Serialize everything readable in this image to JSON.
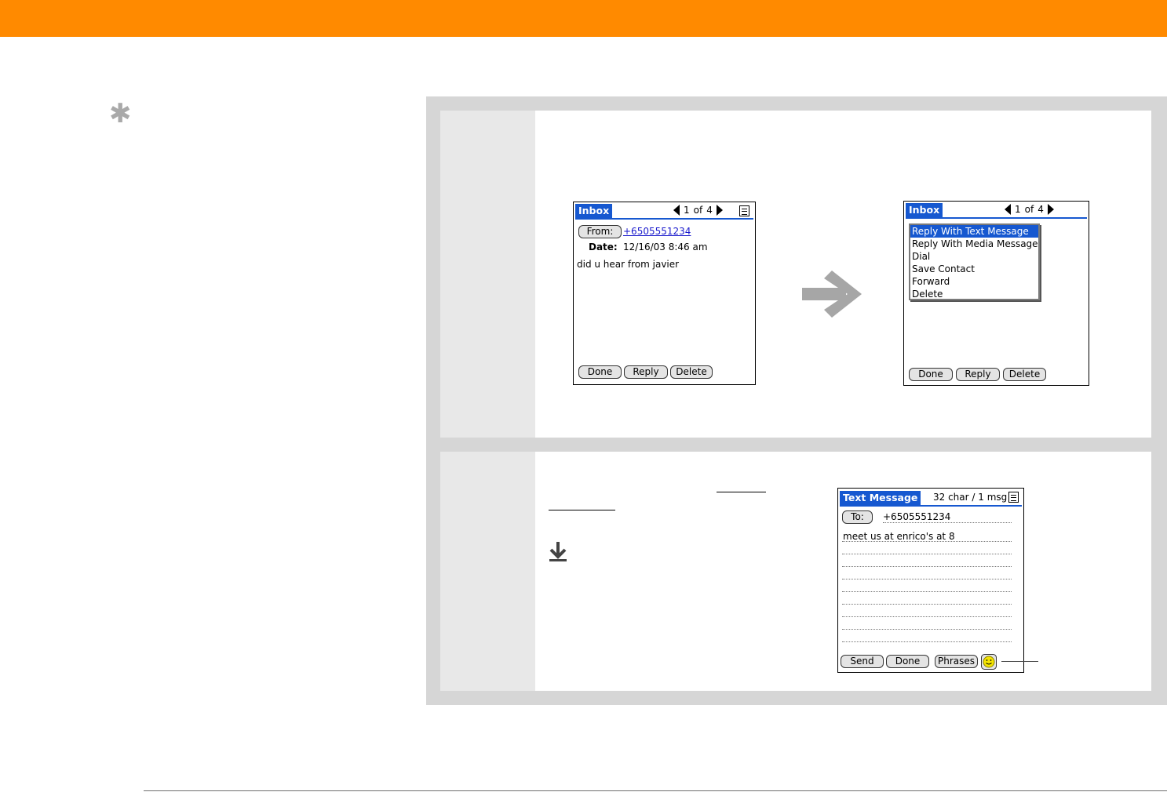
{
  "header": {
    "bar_color": "#ff8a00"
  },
  "sidebar": {
    "tip_icon": "asterisk-icon"
  },
  "step1": {
    "inbox_screen": {
      "title": "Inbox",
      "nav": {
        "position": "1",
        "of": "of",
        "total": "4"
      },
      "from_button": "From:",
      "from_value": "+6505551234",
      "date_label": "Date:",
      "date_value": "12/16/03 8:46 am",
      "message": "did u hear from javier",
      "buttons": {
        "done": "Done",
        "reply": "Reply",
        "delete": "Delete"
      }
    },
    "arrow_icon": "right-arrow-icon",
    "menu_screen": {
      "title": "Inbox",
      "nav": {
        "position": "1",
        "of": "of",
        "total": "4"
      },
      "menu_items": [
        "Reply With Text Message",
        "Reply With Media Message",
        "Dial",
        "Save Contact",
        "Forward",
        "Delete"
      ],
      "selected_item": "Reply With Text Message",
      "buttons": {
        "done": "Done",
        "reply": "Reply",
        "delete": "Delete"
      }
    }
  },
  "step2": {
    "download_icon": "download-arrow-icon",
    "text_message_screen": {
      "title": "Text Message",
      "counter": "32 char / 1 msg",
      "to_button": "To:",
      "to_value": "+6505551234",
      "message": "meet us at enrico's at 8",
      "buttons": {
        "send": "Send",
        "done": "Done",
        "phrases": "Phrases"
      },
      "emoticon_icon": "smiley-icon"
    }
  },
  "colors": {
    "palm_blue": "#1658d0",
    "link_blue": "#1a1acc",
    "frame_gray": "#d6d6d6",
    "number_cell": "#e8e8e8"
  }
}
